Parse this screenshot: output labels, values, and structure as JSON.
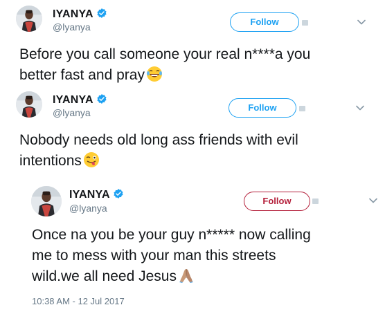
{
  "tweets": [
    {
      "name": "IYANYA",
      "handle": "@lyanya",
      "follow_label": "Follow",
      "lines": [
        "Before you call someone your real n****a you",
        "better fast and pray"
      ],
      "emoji": "laughing-tears-emoji"
    },
    {
      "name": "IYANYA",
      "handle": "@lyanya",
      "follow_label": "Follow",
      "lines": [
        "Nobody needs old long ass friends with evil",
        "intentions"
      ],
      "emoji": "winking-tongue-emoji"
    },
    {
      "name": "IYANYA",
      "handle": "@lyanya",
      "follow_label": "Follow",
      "lines": [
        "Once na you be your guy n***** now calling",
        "me to mess with your man this streets",
        "wild.we all need Jesus"
      ],
      "emoji": "praying-hands-emoji",
      "timestamp": "10:38 AM - 12 Jul 2017"
    }
  ],
  "colors": {
    "accent": "#1da1f2",
    "follow_alt": "#b41f3a",
    "text": "#14171a",
    "muted": "#657786"
  }
}
